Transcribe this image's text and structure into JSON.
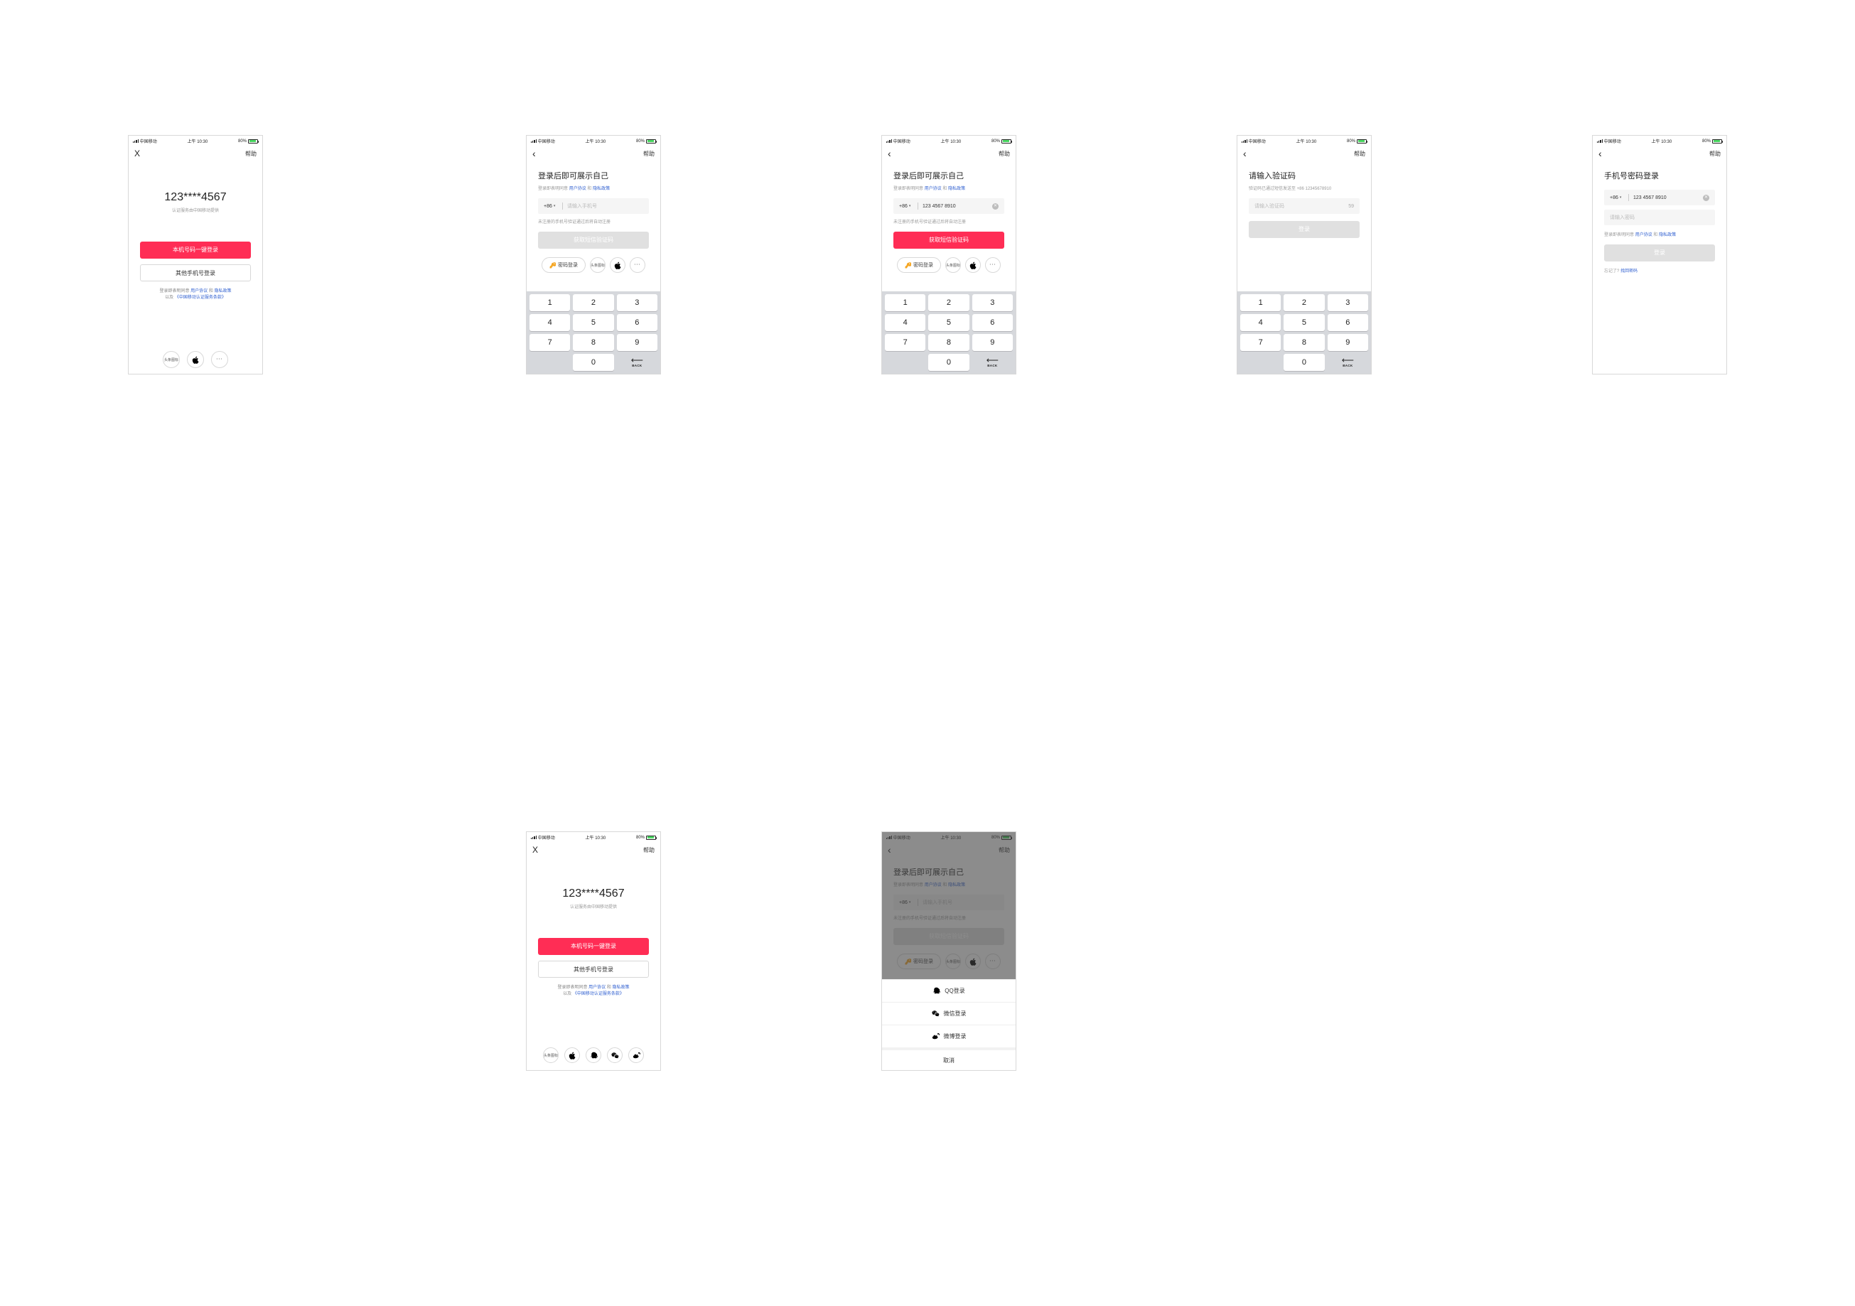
{
  "status": {
    "carrier": "中国移动",
    "time": "上午 10:30",
    "battery": "80%"
  },
  "nav": {
    "close_x": "X",
    "back": "‹",
    "help": "帮助"
  },
  "s1": {
    "masked": "123****4567",
    "sub": "认证服务由中国移动提供",
    "btn_primary": "本机号码一键登录",
    "btn_outline": "其他手机号登录",
    "agree_pre": "登录即表明同意",
    "user_agreement": "用户协议",
    "and": "和",
    "privacy": "隐私政策",
    "plus_pre": "以及",
    "cmcc_terms": "《中国移动认证服务条款》",
    "icon_toutiao": "头条图标"
  },
  "s2": {
    "title": "登录后即可展示自己",
    "agree_pre": "登录即表明同意",
    "user_agreement": "用户协议",
    "and": "和",
    "privacy": "隐私政策",
    "cc": "+86",
    "phone_ph": "请输入手机号",
    "note": "未注册的手机号验证通过后将自动注册",
    "btn_disabled": "获取短信验证码",
    "pill_password": "密码登录",
    "pill_toutiao": "头条图标"
  },
  "s3": {
    "title": "登录后即可展示自己",
    "agree_pre": "登录即表明同意",
    "user_agreement": "用户协议",
    "and": "和",
    "privacy": "隐私政策",
    "cc": "+86",
    "phone_val": "123 4567 8910",
    "note": "未注册的手机号验证通过后将自动注册",
    "btn_primary": "获取短信验证码",
    "pill_password": "密码登录",
    "pill_toutiao": "头条图标"
  },
  "s4": {
    "title": "请输入验证码",
    "sent_note": "验证码已通过短信发送至 +86 12345678910",
    "code_ph": "请输入验证码",
    "timer": "59",
    "btn_disabled": "登录"
  },
  "s5": {
    "title": "手机号密码登录",
    "cc": "+86",
    "phone_val": "123 4567 8910",
    "pwd_ph": "请输入密码",
    "agree_pre": "登录即表明同意",
    "user_agreement": "用户协议",
    "and": "和",
    "privacy": "隐私政策",
    "btn_disabled": "登录",
    "forgot_pre": "忘记了?",
    "forgot_link": "找回密码"
  },
  "s6": {
    "masked": "123****4567",
    "sub": "认证服务由中国移动提供",
    "btn_primary": "本机号码一键登录",
    "btn_outline": "其他手机号登录",
    "agree_pre": "登录即表明同意",
    "user_agreement": "用户协议",
    "and": "和",
    "privacy": "隐私政策",
    "plus_pre": "以及",
    "cmcc_terms": "《中国移动认证服务条款》",
    "icon_toutiao": "头条图标"
  },
  "s7": {
    "title": "登录后即可展示自己",
    "agree_pre": "登录即表明同意",
    "user_agreement": "用户协议",
    "and": "和",
    "privacy": "隐私政策",
    "cc": "+86",
    "phone_ph": "请输入手机号",
    "note": "未注册的手机号验证通过后将自动注册",
    "btn_disabled": "获取短信验证码",
    "pill_password": "密码登录",
    "pill_toutiao": "头条图标",
    "sheet": {
      "qq": "QQ登录",
      "wechat": "微信登录",
      "weibo": "微博登录",
      "cancel": "取消"
    }
  },
  "keypad": {
    "k1": "1",
    "k2": "2",
    "k3": "3",
    "k4": "4",
    "k5": "5",
    "k6": "6",
    "k7": "7",
    "k8": "8",
    "k9": "9",
    "k0": "0",
    "back": "BACK"
  }
}
